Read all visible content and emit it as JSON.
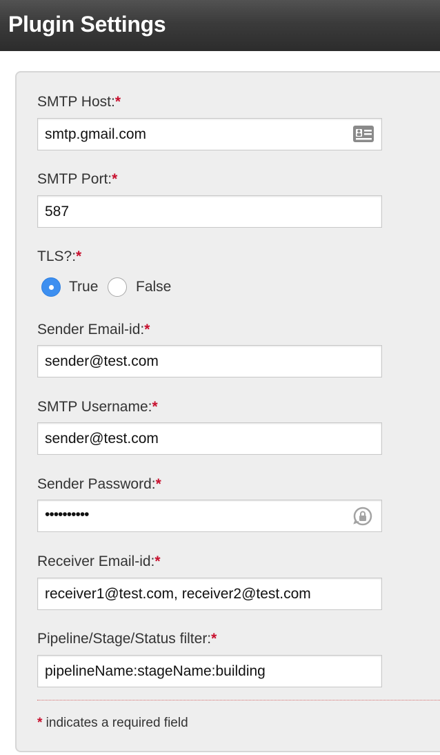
{
  "header": {
    "title": "Plugin Settings"
  },
  "required_marker": "*",
  "fields": {
    "smtp_host": {
      "label": "SMTP Host:",
      "value": "smtp.gmail.com",
      "icon": "contact-card-icon"
    },
    "smtp_port": {
      "label": "SMTP Port:",
      "value": "587"
    },
    "tls": {
      "label": "TLS?:",
      "options": [
        "True",
        "False"
      ],
      "selected": "True"
    },
    "sender_email": {
      "label": "Sender Email-id:",
      "value": "sender@test.com"
    },
    "smtp_username": {
      "label": "SMTP Username:",
      "value": "sender@test.com"
    },
    "sender_password": {
      "label": "Sender Password:",
      "value": "••••••••••",
      "icon": "password-lock-icon"
    },
    "receiver_email": {
      "label": "Receiver Email-id:",
      "value": "receiver1@test.com, receiver2@test.com"
    },
    "filter": {
      "label": "Pipeline/Stage/Status filter:",
      "value": "pipelineName:stageName:building"
    }
  },
  "footnote": {
    "marker": "*",
    "text": " indicates a required field"
  },
  "colors": {
    "required": "#c8102e",
    "radio_selected": "#3d8ff0",
    "header_bg": "#3b3b3b",
    "panel_bg": "#eeeeee"
  }
}
